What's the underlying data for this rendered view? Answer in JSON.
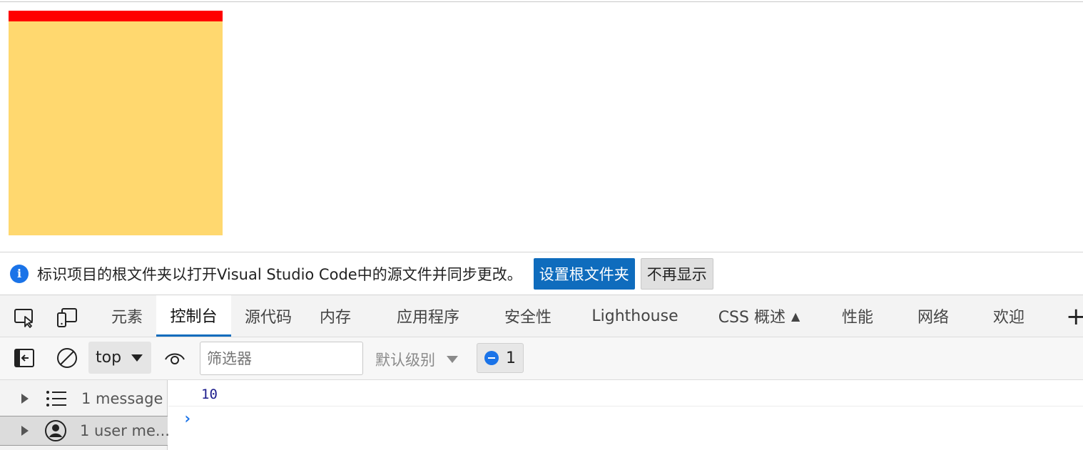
{
  "page": {
    "box_color": "#ffd86f",
    "bar_color": "#ff0000"
  },
  "infobar": {
    "icon": "info-icon",
    "message": "标识项目的根文件夹以打开Visual Studio Code中的源文件并同步更改。",
    "primary_button": "设置根文件夹",
    "secondary_button": "不再显示"
  },
  "devtools": {
    "tabs": [
      {
        "label": "元素",
        "active": false
      },
      {
        "label": "控制台",
        "active": true
      },
      {
        "label": "源代码",
        "active": false
      },
      {
        "label": "内存",
        "active": false
      },
      {
        "label": "应用程序",
        "active": false
      },
      {
        "label": "安全性",
        "active": false
      },
      {
        "label": "Lighthouse",
        "active": false
      },
      {
        "label": "CSS 概述",
        "active": false
      },
      {
        "label": "性能",
        "active": false
      },
      {
        "label": "网络",
        "active": false
      },
      {
        "label": "欢迎",
        "active": false
      }
    ],
    "add_tab": "+",
    "accent": "#0f6cbd"
  },
  "console_toolbar": {
    "context": "top",
    "filter_placeholder": "筛选器",
    "level": "默认级别",
    "issues_count": "1"
  },
  "sidebar": {
    "items": [
      {
        "label": "1 message",
        "icon": "list-icon"
      },
      {
        "label": "1 user me...",
        "icon": "user-icon"
      }
    ]
  },
  "console": {
    "entries": [
      {
        "value": "10"
      }
    ],
    "prompt": "›"
  }
}
